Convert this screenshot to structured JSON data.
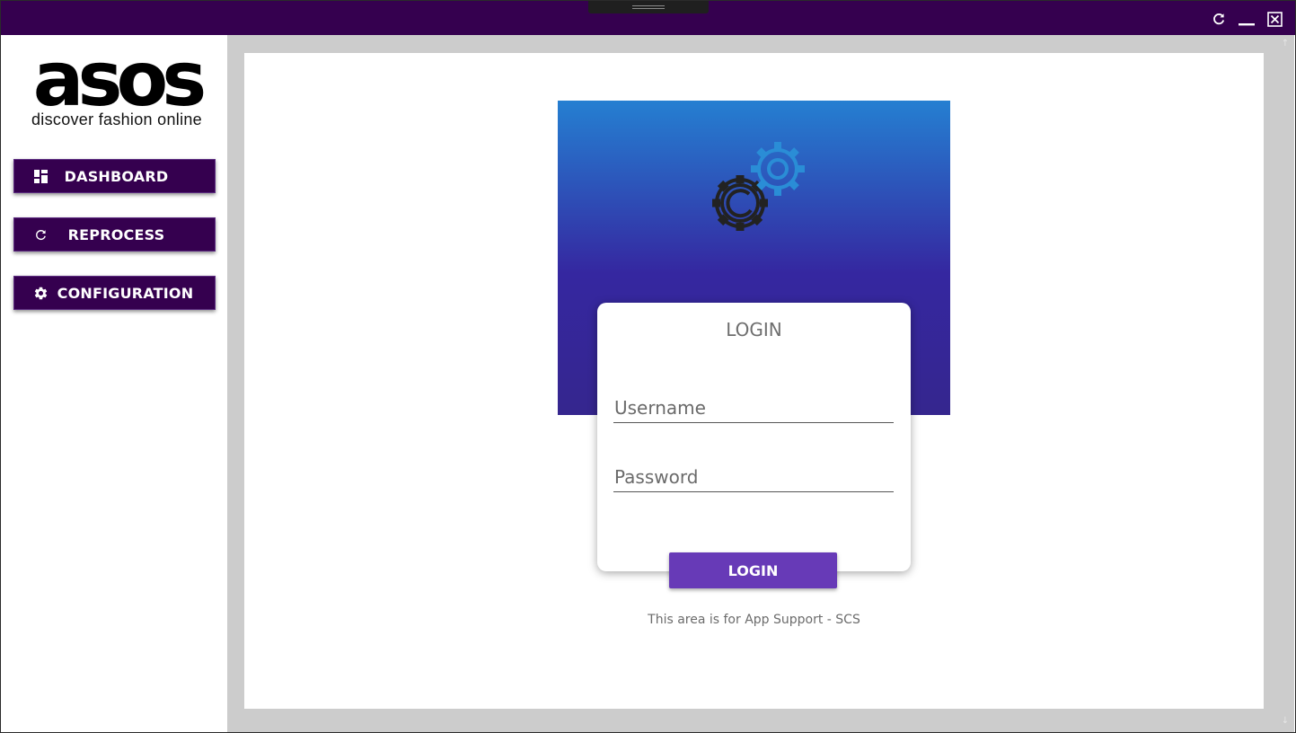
{
  "titlebar": {
    "refresh_icon": "refresh-icon",
    "minimize_icon": "minimize-icon",
    "close_icon": "close-box-icon"
  },
  "logo": {
    "wordmark": "asos",
    "tagline": "discover fashion online"
  },
  "sidebar": {
    "items": [
      {
        "label": "DASHBOARD",
        "icon": "dashboard-icon"
      },
      {
        "label": "REPROCESS",
        "icon": "refresh-icon"
      },
      {
        "label": "CONFIGURATION",
        "icon": "gear-icon"
      }
    ]
  },
  "hero": {
    "icon": "gears-icon",
    "gradient_top": "#257fd1",
    "gradient_bottom": "#35268e"
  },
  "login": {
    "title": "LOGIN",
    "username_placeholder": "Username",
    "password_placeholder": "Password",
    "button_label": "LOGIN",
    "note": "This area is for App Support - SCS"
  },
  "colors": {
    "titlebar": "#35004f",
    "nav_button": "#35004f",
    "login_button": "#673ab7",
    "content_gutter": "#cccccc"
  }
}
